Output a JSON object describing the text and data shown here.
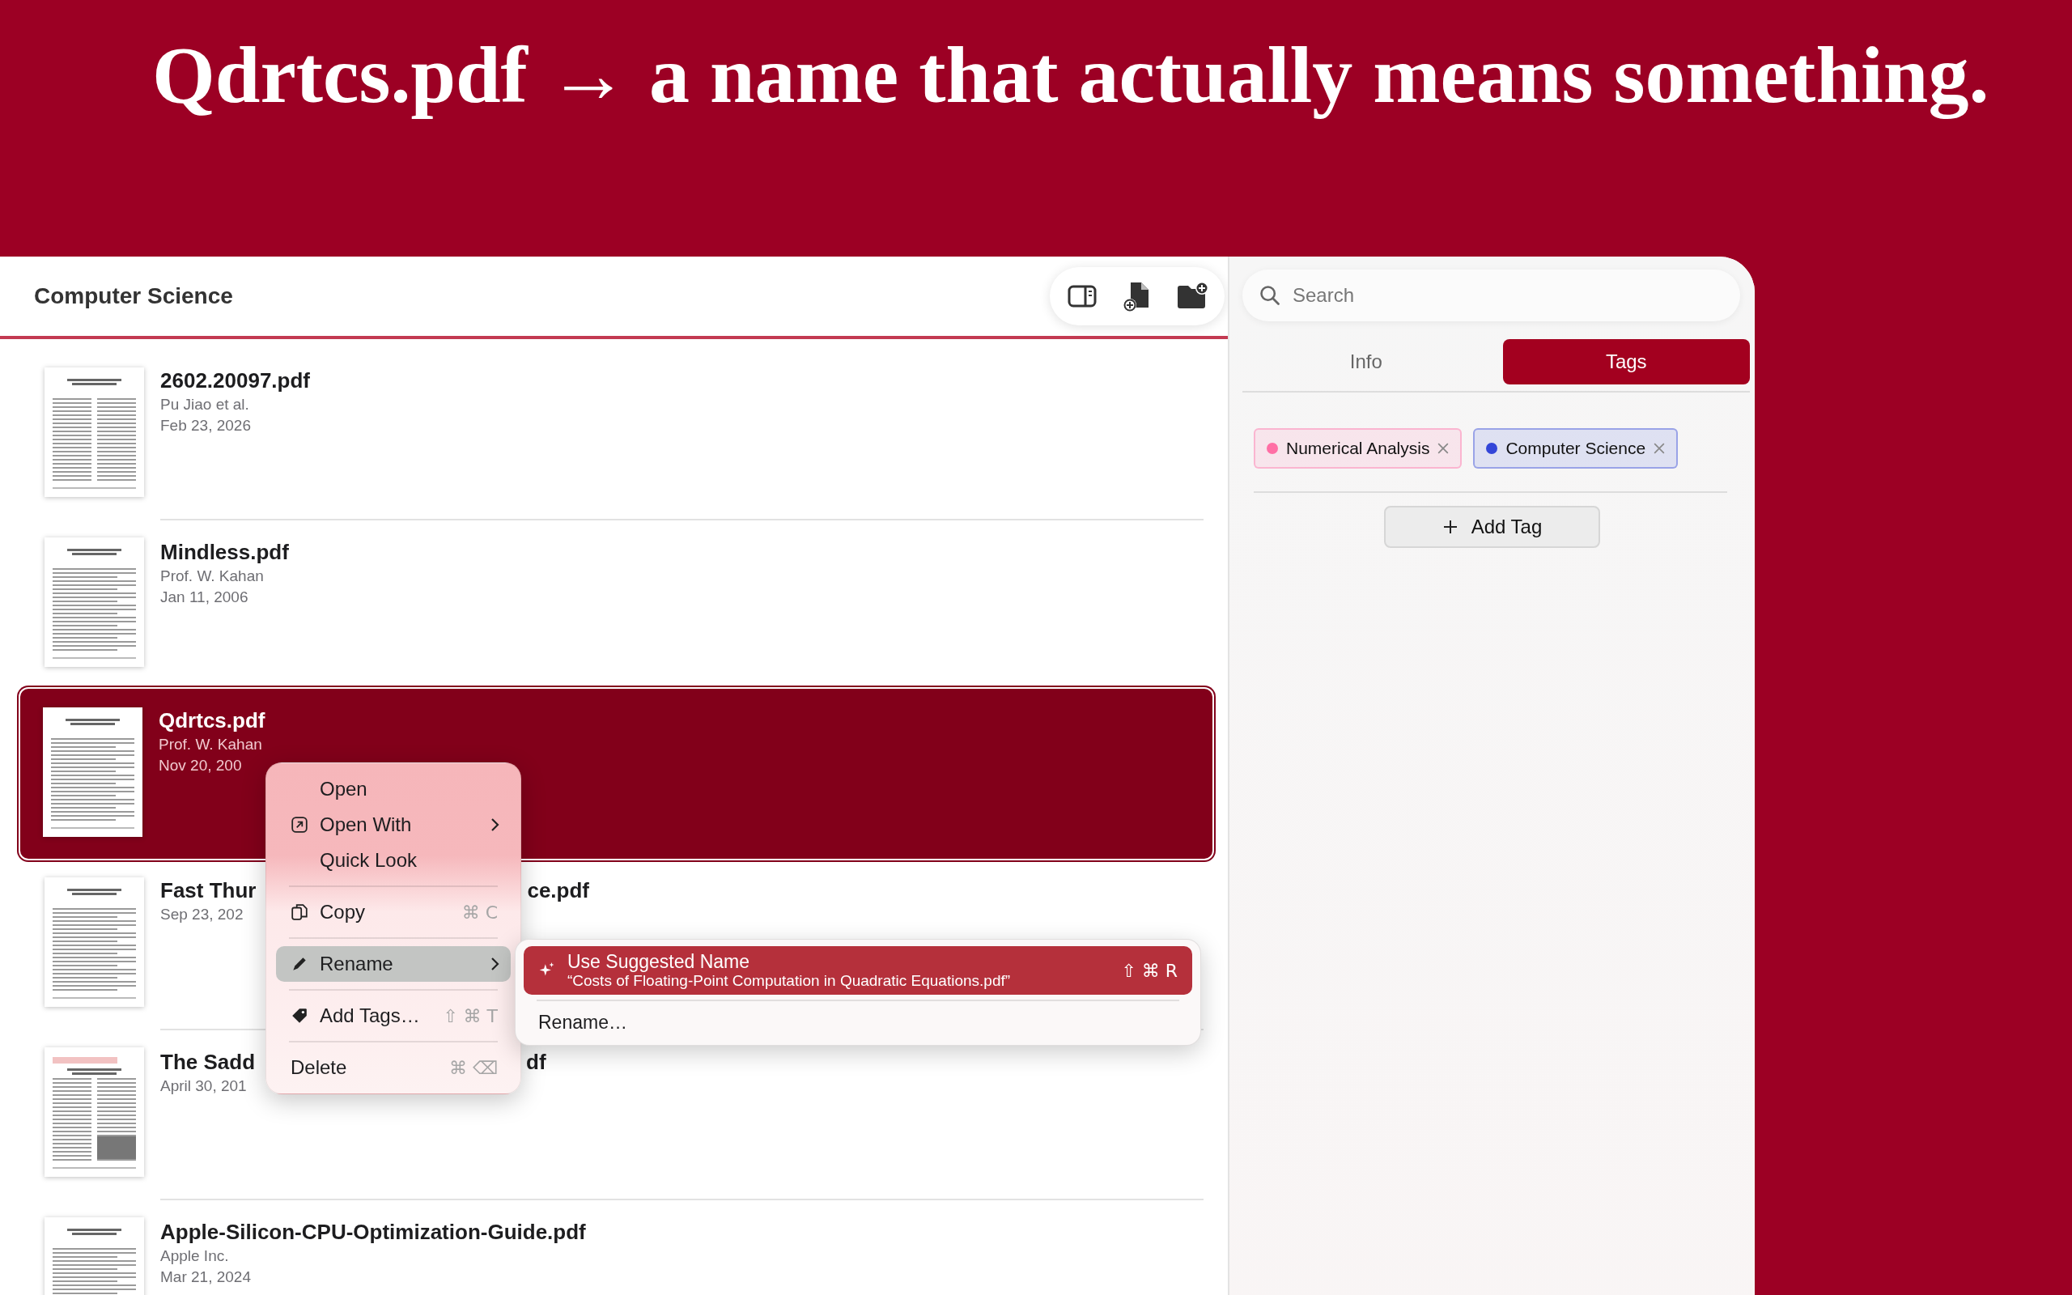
{
  "headline": "Qdrtcs.pdf → a name that actually means something.",
  "library": {
    "title": "Computer Science",
    "files": [
      {
        "title_parts": [
          "2602.20097.pdf"
        ],
        "author": "Pu Jiao et al.",
        "date": "Feb 23, 2026",
        "selected": false
      },
      {
        "title_parts": [
          "Mindless.pdf"
        ],
        "author": "Prof. W. Kahan",
        "date": "Jan 11, 2006",
        "selected": false
      },
      {
        "title_parts": [
          "Qdrtcs.pdf"
        ],
        "author": "Prof. W. Kahan",
        "date": "Nov 20, 200",
        "selected": true
      },
      {
        "title_parts": [
          "Fast Thur",
          "ce.pdf"
        ],
        "date": "Sep 23, 202",
        "selected": false
      },
      {
        "title_parts": [
          "The Sadd",
          "df"
        ],
        "date": "April 30, 201",
        "selected": false
      },
      {
        "title_parts": [
          "Apple-Silicon-CPU-Optimization-Guide.pdf"
        ],
        "author": "Apple Inc.",
        "date": "Mar 21, 2024",
        "selected": false
      }
    ]
  },
  "inspector": {
    "search": {
      "placeholder": "Search"
    },
    "tabs": [
      {
        "label": "Info",
        "selected": false
      },
      {
        "label": "Tags",
        "selected": true
      }
    ],
    "tags": [
      {
        "label": "Numerical Analysis",
        "color": "#ff6fa5"
      },
      {
        "label": "Computer Science",
        "color": "#3346d8"
      }
    ],
    "add_button": "Add Tag"
  },
  "context_menu": {
    "items": [
      {
        "kind": "item",
        "label": "Open",
        "submenu": false,
        "selected": false
      },
      {
        "kind": "item",
        "label": "Open With",
        "submenu": true,
        "selected": false
      },
      {
        "kind": "item",
        "label": "Quick Look",
        "submenu": false,
        "selected": false
      },
      {
        "kind": "separator"
      },
      {
        "kind": "item",
        "label": "Copy",
        "shortcut": "⌘ C",
        "submenu": false,
        "selected": false
      },
      {
        "kind": "separator"
      },
      {
        "kind": "item",
        "label": "Rename",
        "submenu": true,
        "selected": true
      },
      {
        "kind": "separator"
      },
      {
        "kind": "item",
        "label": "Add Tags…",
        "shortcut": "⇧ ⌘ T",
        "submenu": false,
        "selected": false
      },
      {
        "kind": "separator"
      },
      {
        "kind": "plain",
        "label": "Delete",
        "shortcut": "⌘ ⌫",
        "submenu": false,
        "selected": false
      }
    ]
  },
  "submenu": {
    "items": [
      {
        "kind": "item",
        "label": "Use Suggested Name",
        "detail": "“Costs of Floating-Point Computation in Quadratic Equations.pdf”",
        "shortcut": "⇧ ⌘ R",
        "selected": true
      },
      {
        "kind": "separator"
      },
      {
        "kind": "item",
        "label": "Rename…",
        "selected": false
      }
    ]
  }
}
